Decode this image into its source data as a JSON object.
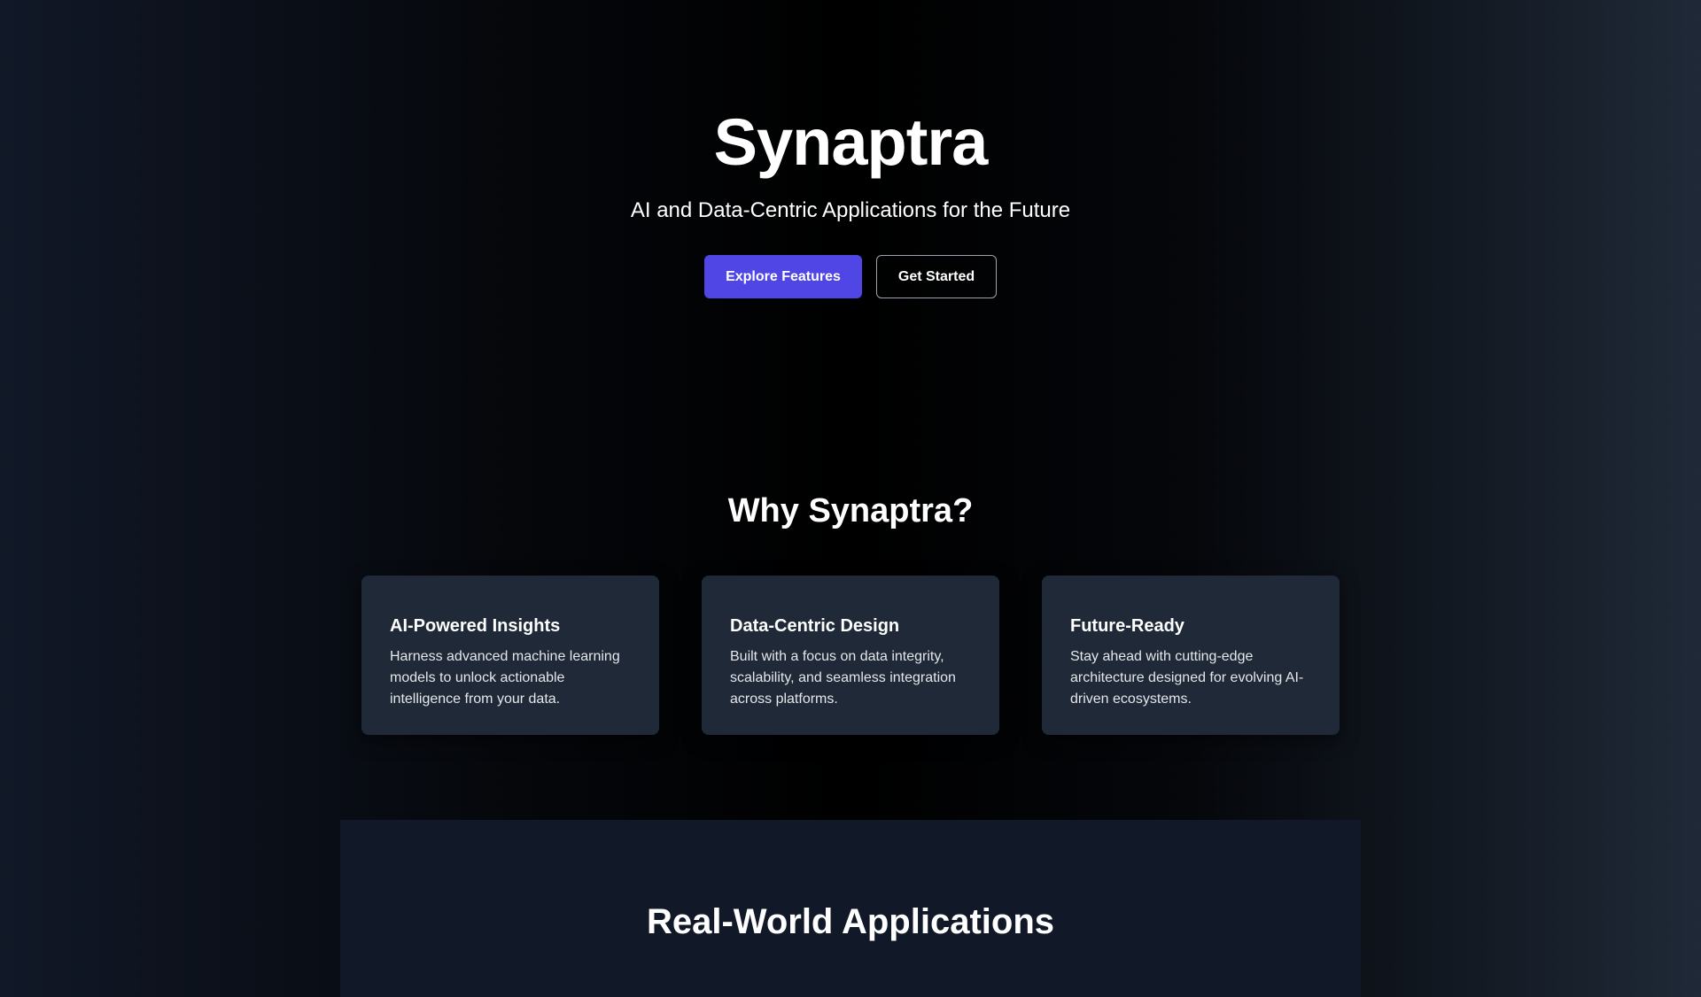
{
  "hero": {
    "title": "Synaptra",
    "subtitle": "AI and Data-Centric Applications for the Future",
    "primary_button": "Explore Features",
    "secondary_button": "Get Started"
  },
  "features": {
    "heading": "Why Synaptra?",
    "cards": [
      {
        "title": "AI-Powered Insights",
        "text": "Harness advanced machine learning models to unlock actionable intelligence from your data."
      },
      {
        "title": "Data-Centric Design",
        "text": "Built with a focus on data integrity, scalability, and seamless integration across platforms."
      },
      {
        "title": "Future-Ready",
        "text": "Stay ahead with cutting-edge architecture designed for evolving AI-driven ecosystems."
      }
    ]
  },
  "applications": {
    "heading": "Real-World Applications"
  },
  "colors": {
    "accent": "#4f46e5",
    "card": "#1f2937",
    "section": "#111827"
  }
}
